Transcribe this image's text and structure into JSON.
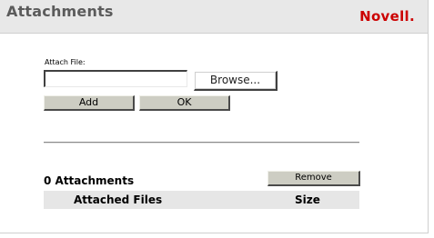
{
  "header": {
    "title": "Attachments",
    "brand": "Novell."
  },
  "attach": {
    "label": "Attach File:",
    "file_value": "",
    "browse_label": "Browse...",
    "add_label": "Add",
    "ok_label": "OK"
  },
  "attachments": {
    "count_text": "0 Attachments",
    "remove_label": "Remove",
    "columns": [
      "Attached Files",
      "Size"
    ],
    "rows": []
  },
  "colors": {
    "header_bg": "#e8e8e8",
    "brand_red": "#cc0000",
    "button_gray": "#cdcdc3"
  }
}
